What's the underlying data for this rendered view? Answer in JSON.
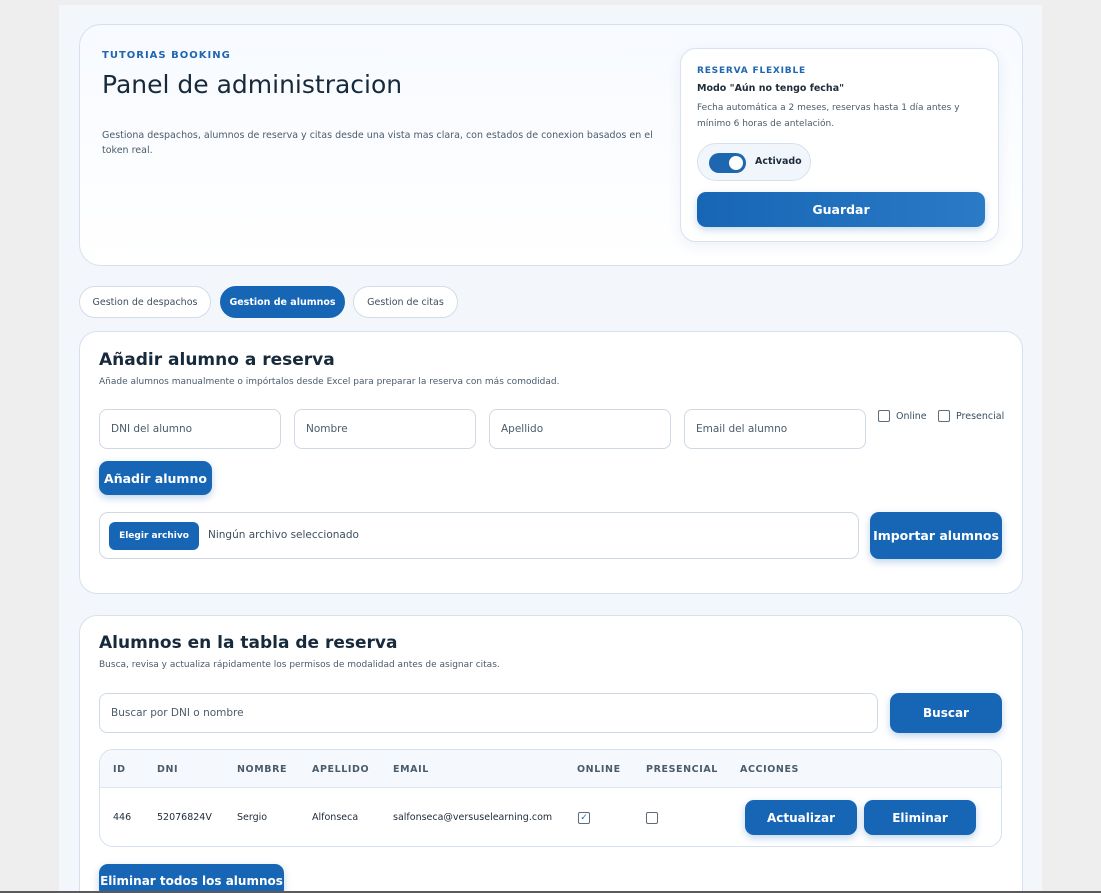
{
  "hero": {
    "eyebrow": "TUTORIAS BOOKING",
    "title": "Panel de administracion",
    "description": "Gestiona despachos, alumnos de reserva y citas desde una vista mas clara, con estados de conexion basados en el token real."
  },
  "flex": {
    "eyebrow": "RESERVA FLEXIBLE",
    "mode": "Modo \"Aún no tengo fecha\"",
    "description": "Fecha automática a 2 meses, reservas hasta 1 día antes y mínimo 6 horas de antelación.",
    "toggle_label": "Activado",
    "toggle_on": true,
    "save_label": "Guardar"
  },
  "tabs": [
    {
      "label": "Gestion de despachos",
      "active": false
    },
    {
      "label": "Gestion de alumnos",
      "active": true
    },
    {
      "label": "Gestion de citas",
      "active": false
    }
  ],
  "add": {
    "title": "Añadir alumno a reserva",
    "subtitle": "Añade alumnos manualmente o impórtalos desde Excel para preparar la reserva con más comodidad.",
    "dni_placeholder": "DNI del alumno",
    "name_placeholder": "Nombre",
    "surname_placeholder": "Apellido",
    "email_placeholder": "Email del alumno",
    "online_label": "Online",
    "presencial_label": "Presencial",
    "add_button": "Añadir alumno",
    "file_button": "Elegir archivo",
    "file_status": "Ningún archivo seleccionado",
    "import_button": "Importar alumnos"
  },
  "list": {
    "title": "Alumnos en la tabla de reserva",
    "subtitle": "Busca, revisa y actualiza rápidamente los permisos de modalidad antes de asignar citas.",
    "search_placeholder": "Buscar por DNI o nombre",
    "search_button": "Buscar",
    "columns": [
      "ID",
      "DNI",
      "NOMBRE",
      "APELLIDO",
      "EMAIL",
      "ONLINE",
      "PRESENCIAL",
      "ACCIONES"
    ],
    "rows": [
      {
        "id": "446",
        "dni": "52076824V",
        "nombre": "Sergio",
        "apellido": "Alfonseca",
        "email": "salfonseca@versuselearning.com",
        "online": true,
        "presencial": false,
        "update_label": "Actualizar",
        "delete_label": "Eliminar"
      }
    ],
    "delete_all_button": "Eliminar todos los alumnos"
  },
  "colors": {
    "accent": "#1766b5",
    "eyebrow": "#1e66b0",
    "page_background": "#f3f7fc"
  }
}
